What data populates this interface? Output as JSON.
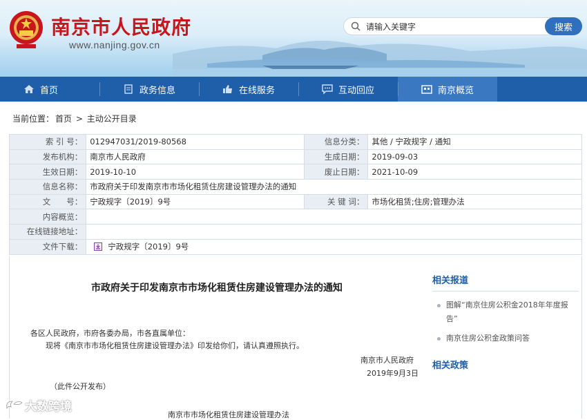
{
  "header": {
    "site_title": "南京市人民政府",
    "site_url": "www.nanjing.gov.cn",
    "search_placeholder": "请输入关键字",
    "search_button": "搜索"
  },
  "nav": {
    "items": [
      {
        "label": "首页",
        "icon": "home-icon"
      },
      {
        "label": "政务信息",
        "icon": "document-icon"
      },
      {
        "label": "在线服务",
        "icon": "thumb-icon"
      },
      {
        "label": "互动回应",
        "icon": "chat-icon"
      },
      {
        "label": "南京概览",
        "icon": "city-icon",
        "active": true
      }
    ]
  },
  "breadcrumb": {
    "prefix": "当前位置：",
    "home": "首页",
    "sep": ">",
    "current": "主动公开目录"
  },
  "info": {
    "index_label": "索 引 号：",
    "index_value": "012947031/2019-80568",
    "category_label": "信息分类：",
    "category_value": "其他 / 宁政规字 / 通知",
    "publisher_label": "发布机构：",
    "publisher_value": "南京市人民政府",
    "created_label": "生成日期：",
    "created_value": "2019-09-03",
    "effective_label": "生效日期：",
    "effective_value": "2019-10-10",
    "expiry_label": "废止日期：",
    "expiry_value": "2021-10-09",
    "name_label": "信息名称：",
    "name_value": "市政府关于印发南京市市场化租赁住房建设管理办法的通知",
    "docno_label": "文　　号：",
    "docno_value": "宁政规字〔2019〕9号",
    "keywords_label": "关 键 词：",
    "keywords_value": "市场化租赁;住房;管理办法",
    "summary_label": "内容概览：",
    "summary_value": "",
    "link_label": "在线链接地址：",
    "link_value": "",
    "download_label": "文件下载：",
    "download_value": "宁政规字〔2019〕9号"
  },
  "content": {
    "title": "市政府关于印发南京市市场化租赁住房建设管理办法的通知",
    "addressee": "各区人民政府，市府各委办局，市各直属单位：",
    "body": "现将《南京市市场化租赁住房建设管理办法》印发给你们，请认真遵照执行。",
    "signer": "南京市人民政府",
    "date": "2019年9月3日",
    "publish_note": "（此件公开发布）",
    "attachment_title": "南京市市场化租赁住房建设管理办法"
  },
  "sidebar": {
    "related_reports_title": "相关报道",
    "related_reports": [
      "图解“南京住房公积金2018年年度报告”",
      "南京住房公积金政策问答"
    ],
    "related_policies_title": "相关政策"
  },
  "watermark": "大数跨境",
  "colors": {
    "brand_red": "#c8161d",
    "nav_blue": "#1f5ea8",
    "nav_active": "#3a78c2",
    "label_bg": "#e9eef5"
  }
}
